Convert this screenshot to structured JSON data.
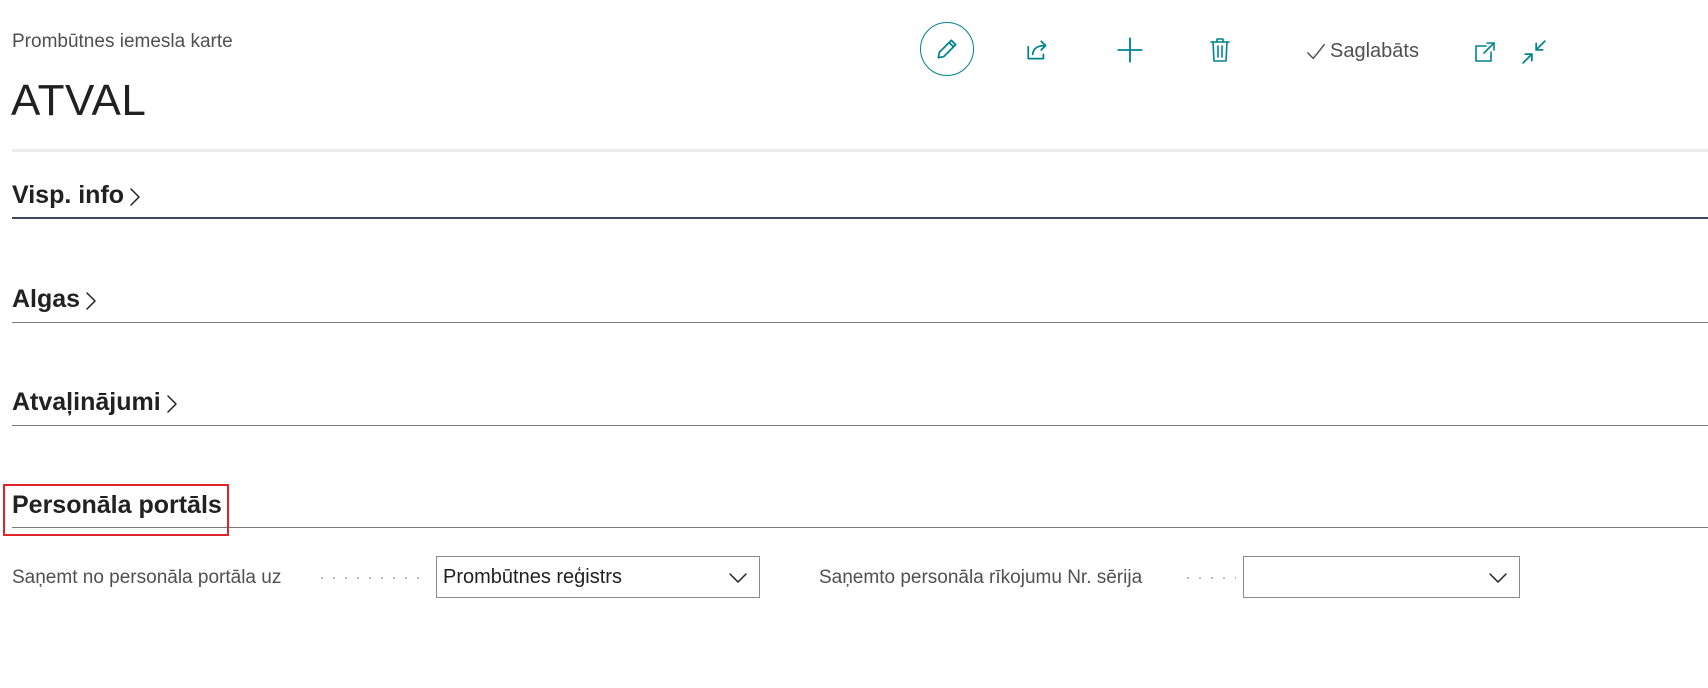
{
  "header": {
    "caption": "Prombūtnes iemesla karte",
    "title": "ATVAL"
  },
  "toolbar": {
    "edit_icon": "pencil-icon",
    "share_icon": "share-icon",
    "new_icon": "plus-icon",
    "delete_icon": "trash-icon",
    "saved_label": "Saglabāts",
    "open_new_window_icon": "open-in-new-window-icon",
    "collapse_icon": "collapse-icon"
  },
  "sections": {
    "general": {
      "label": "Visp. info"
    },
    "salary": {
      "label": "Algas"
    },
    "vacations": {
      "label": "Atvaļinājumi"
    },
    "portal": {
      "label": "Personāla portāls"
    }
  },
  "fields": {
    "receive_from_portal": {
      "label": "Saņemt no personāla portāla uz",
      "value": "Prombūtnes reģistrs"
    },
    "order_no_series": {
      "label": "Saņemto personāla rīkojumu Nr. sērija",
      "value": ""
    }
  },
  "colors": {
    "accent": "#00838f",
    "highlight": "#e0242b",
    "text": "#212121",
    "muted": "#505050"
  }
}
